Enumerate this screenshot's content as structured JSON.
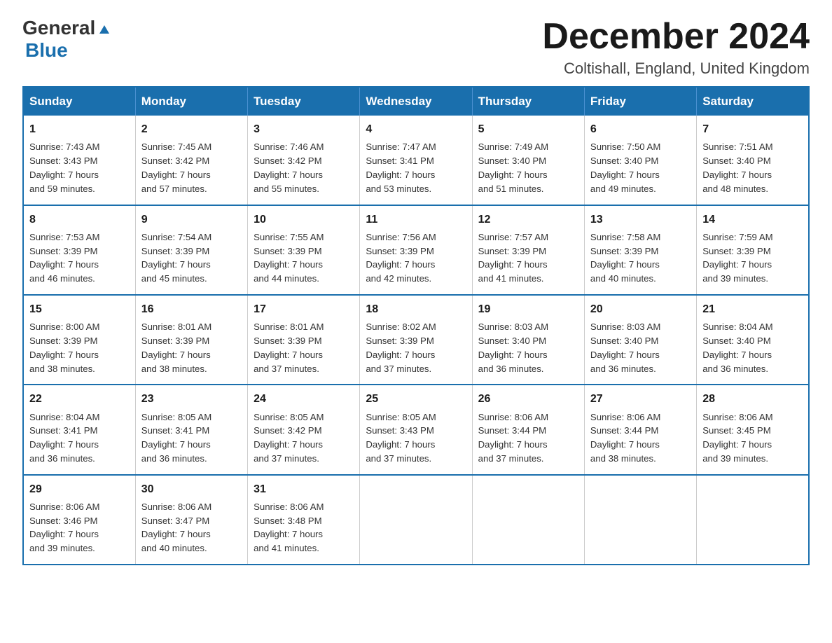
{
  "header": {
    "logo_general": "General",
    "logo_blue": "Blue",
    "title": "December 2024",
    "location": "Coltishall, England, United Kingdom"
  },
  "columns": [
    "Sunday",
    "Monday",
    "Tuesday",
    "Wednesday",
    "Thursday",
    "Friday",
    "Saturday"
  ],
  "weeks": [
    [
      {
        "day": "1",
        "sunrise": "7:43 AM",
        "sunset": "3:43 PM",
        "daylight": "7 hours and 59 minutes."
      },
      {
        "day": "2",
        "sunrise": "7:45 AM",
        "sunset": "3:42 PM",
        "daylight": "7 hours and 57 minutes."
      },
      {
        "day": "3",
        "sunrise": "7:46 AM",
        "sunset": "3:42 PM",
        "daylight": "7 hours and 55 minutes."
      },
      {
        "day": "4",
        "sunrise": "7:47 AM",
        "sunset": "3:41 PM",
        "daylight": "7 hours and 53 minutes."
      },
      {
        "day": "5",
        "sunrise": "7:49 AM",
        "sunset": "3:40 PM",
        "daylight": "7 hours and 51 minutes."
      },
      {
        "day": "6",
        "sunrise": "7:50 AM",
        "sunset": "3:40 PM",
        "daylight": "7 hours and 49 minutes."
      },
      {
        "day": "7",
        "sunrise": "7:51 AM",
        "sunset": "3:40 PM",
        "daylight": "7 hours and 48 minutes."
      }
    ],
    [
      {
        "day": "8",
        "sunrise": "7:53 AM",
        "sunset": "3:39 PM",
        "daylight": "7 hours and 46 minutes."
      },
      {
        "day": "9",
        "sunrise": "7:54 AM",
        "sunset": "3:39 PM",
        "daylight": "7 hours and 45 minutes."
      },
      {
        "day": "10",
        "sunrise": "7:55 AM",
        "sunset": "3:39 PM",
        "daylight": "7 hours and 44 minutes."
      },
      {
        "day": "11",
        "sunrise": "7:56 AM",
        "sunset": "3:39 PM",
        "daylight": "7 hours and 42 minutes."
      },
      {
        "day": "12",
        "sunrise": "7:57 AM",
        "sunset": "3:39 PM",
        "daylight": "7 hours and 41 minutes."
      },
      {
        "day": "13",
        "sunrise": "7:58 AM",
        "sunset": "3:39 PM",
        "daylight": "7 hours and 40 minutes."
      },
      {
        "day": "14",
        "sunrise": "7:59 AM",
        "sunset": "3:39 PM",
        "daylight": "7 hours and 39 minutes."
      }
    ],
    [
      {
        "day": "15",
        "sunrise": "8:00 AM",
        "sunset": "3:39 PM",
        "daylight": "7 hours and 38 minutes."
      },
      {
        "day": "16",
        "sunrise": "8:01 AM",
        "sunset": "3:39 PM",
        "daylight": "7 hours and 38 minutes."
      },
      {
        "day": "17",
        "sunrise": "8:01 AM",
        "sunset": "3:39 PM",
        "daylight": "7 hours and 37 minutes."
      },
      {
        "day": "18",
        "sunrise": "8:02 AM",
        "sunset": "3:39 PM",
        "daylight": "7 hours and 37 minutes."
      },
      {
        "day": "19",
        "sunrise": "8:03 AM",
        "sunset": "3:40 PM",
        "daylight": "7 hours and 36 minutes."
      },
      {
        "day": "20",
        "sunrise": "8:03 AM",
        "sunset": "3:40 PM",
        "daylight": "7 hours and 36 minutes."
      },
      {
        "day": "21",
        "sunrise": "8:04 AM",
        "sunset": "3:40 PM",
        "daylight": "7 hours and 36 minutes."
      }
    ],
    [
      {
        "day": "22",
        "sunrise": "8:04 AM",
        "sunset": "3:41 PM",
        "daylight": "7 hours and 36 minutes."
      },
      {
        "day": "23",
        "sunrise": "8:05 AM",
        "sunset": "3:41 PM",
        "daylight": "7 hours and 36 minutes."
      },
      {
        "day": "24",
        "sunrise": "8:05 AM",
        "sunset": "3:42 PM",
        "daylight": "7 hours and 37 minutes."
      },
      {
        "day": "25",
        "sunrise": "8:05 AM",
        "sunset": "3:43 PM",
        "daylight": "7 hours and 37 minutes."
      },
      {
        "day": "26",
        "sunrise": "8:06 AM",
        "sunset": "3:44 PM",
        "daylight": "7 hours and 37 minutes."
      },
      {
        "day": "27",
        "sunrise": "8:06 AM",
        "sunset": "3:44 PM",
        "daylight": "7 hours and 38 minutes."
      },
      {
        "day": "28",
        "sunrise": "8:06 AM",
        "sunset": "3:45 PM",
        "daylight": "7 hours and 39 minutes."
      }
    ],
    [
      {
        "day": "29",
        "sunrise": "8:06 AM",
        "sunset": "3:46 PM",
        "daylight": "7 hours and 39 minutes."
      },
      {
        "day": "30",
        "sunrise": "8:06 AM",
        "sunset": "3:47 PM",
        "daylight": "7 hours and 40 minutes."
      },
      {
        "day": "31",
        "sunrise": "8:06 AM",
        "sunset": "3:48 PM",
        "daylight": "7 hours and 41 minutes."
      },
      null,
      null,
      null,
      null
    ]
  ],
  "labels": {
    "sunrise": "Sunrise:",
    "sunset": "Sunset:",
    "daylight": "Daylight:"
  }
}
